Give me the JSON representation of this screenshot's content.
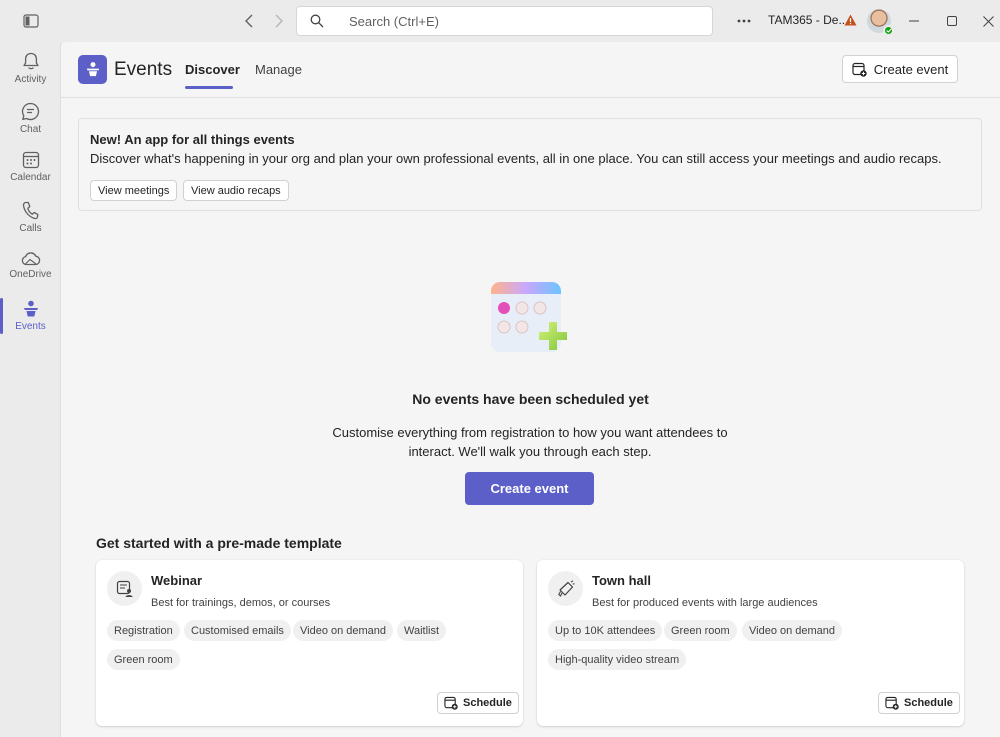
{
  "titlebar": {
    "search_placeholder": "Search (Ctrl+E)",
    "tenant_label": "TAM365 - De...",
    "icons": [
      "sidebar-toggle-icon",
      "back-icon",
      "forward-icon",
      "search-icon",
      "more-icon",
      "warning-icon",
      "minimize-icon",
      "maximize-icon",
      "close-icon"
    ]
  },
  "rail": {
    "items": [
      {
        "label": "Activity",
        "icon": "bell-icon"
      },
      {
        "label": "Chat",
        "icon": "chat-icon"
      },
      {
        "label": "Calendar",
        "icon": "calendar-icon"
      },
      {
        "label": "Calls",
        "icon": "phone-icon"
      },
      {
        "label": "OneDrive",
        "icon": "cloud-icon"
      },
      {
        "label": "Events",
        "icon": "events-icon"
      }
    ],
    "active": "Events"
  },
  "header": {
    "title": "Events",
    "tabs": [
      {
        "label": "Discover",
        "active": true
      },
      {
        "label": "Manage",
        "active": false
      }
    ],
    "create_event_label": "Create event"
  },
  "banner": {
    "title": "New! An app for all things events",
    "text": "Discover what's happening in your org and plan your own professional events, all in one place. You can still access your meetings and audio recaps.",
    "buttons": [
      "View meetings",
      "View audio recaps"
    ]
  },
  "empty_state": {
    "title": "No events have been scheduled yet",
    "text": "Customise everything from registration to how you want attendees to interact. We'll walk you through each step.",
    "button": "Create event"
  },
  "templates": {
    "heading": "Get started with a pre-made template",
    "cards": [
      {
        "title": "Webinar",
        "description": "Best for trainings, demos, or courses",
        "chips": [
          "Registration",
          "Customised emails",
          "Video on demand",
          "Waitlist",
          "Green room"
        ],
        "schedule_label": "Schedule"
      },
      {
        "title": "Town hall",
        "description": "Best for produced events with large audiences",
        "chips": [
          "Up to 10K attendees",
          "Green room",
          "Video on demand",
          "High-quality video stream"
        ],
        "schedule_label": "Schedule"
      }
    ]
  },
  "colors": {
    "accent": "#5b5fc7",
    "background": "#f5f5f5",
    "rail": "#ebebeb",
    "presence": "#13a10e",
    "warning": "#c4501b"
  }
}
